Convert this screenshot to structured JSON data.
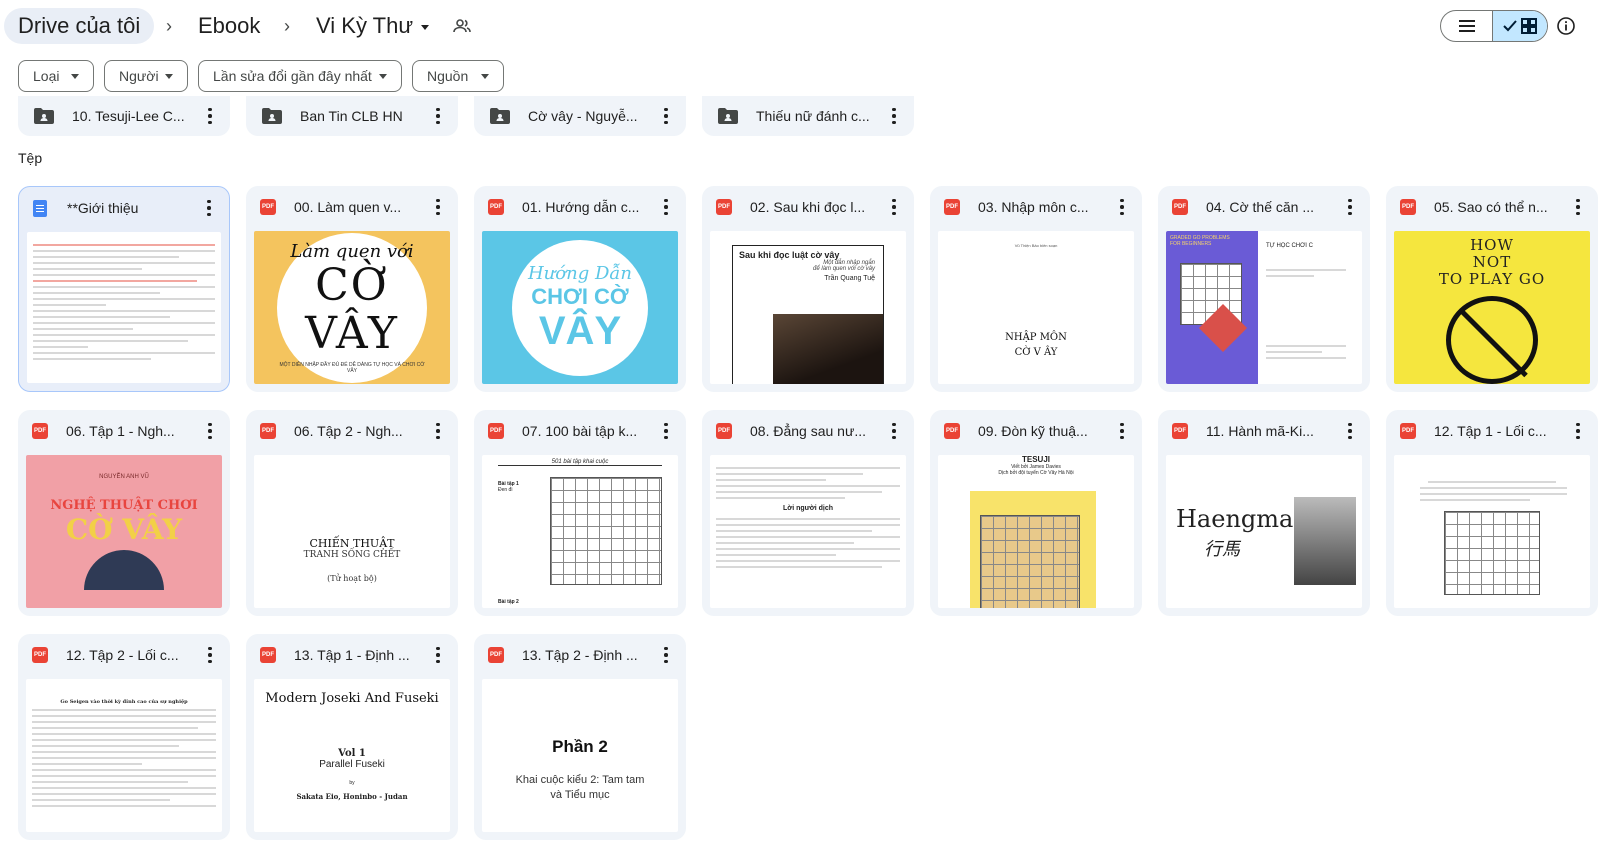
{
  "breadcrumb": {
    "root": "Drive của tôi",
    "level1": "Ebook",
    "current": "Vi Kỳ Thư"
  },
  "filters": [
    {
      "label": "Loại"
    },
    {
      "label": "Người"
    },
    {
      "label": "Lần sửa đổi gần đây nhất"
    },
    {
      "label": "Nguồn"
    }
  ],
  "folders": [
    {
      "name": "10. Tesuji-Lee C..."
    },
    {
      "name": "Ban Tin CLB HN"
    },
    {
      "name": "Cờ vây - Nguyễ..."
    },
    {
      "name": "Thiếu nữ đánh c..."
    }
  ],
  "files_section_label": "Tệp",
  "file_icon_label": "PDF",
  "files": [
    {
      "name": "**Giới thiệu",
      "type": "doc"
    },
    {
      "name": "00. Làm quen v...",
      "type": "pdf"
    },
    {
      "name": "01. Hướng dẫn c...",
      "type": "pdf"
    },
    {
      "name": "02. Sau khi đọc l...",
      "type": "pdf"
    },
    {
      "name": "03. Nhập môn c...",
      "type": "pdf"
    },
    {
      "name": "04. Cờ thế căn ...",
      "type": "pdf"
    },
    {
      "name": "05. Sao có thể n...",
      "type": "pdf"
    },
    {
      "name": "06. Tập 1 - Ngh...",
      "type": "pdf"
    },
    {
      "name": "06. Tập 2 - Ngh...",
      "type": "pdf"
    },
    {
      "name": "07. 100 bài tập k...",
      "type": "pdf"
    },
    {
      "name": "08. Đẳng sau nư...",
      "type": "pdf"
    },
    {
      "name": "09. Đòn kỹ thuậ...",
      "type": "pdf"
    },
    {
      "name": "11. Hành mã-Ki...",
      "type": "pdf"
    },
    {
      "name": "12. Tập 1 - Lối c...",
      "type": "pdf"
    },
    {
      "name": "12. Tập 2 - Lối c...",
      "type": "pdf"
    },
    {
      "name": "13. Tập 1 - Định ...",
      "type": "pdf"
    },
    {
      "name": "13. Tập 2 - Định ...",
      "type": "pdf"
    }
  ],
  "thumbs": {
    "t1": {
      "small": "Làm quen với",
      "big": "CỜ VÂY",
      "tiny": "MỘT DIỄN NHẬP ĐẦY ĐỦ ĐỂ DỄ DÀNG TỰ HỌC VÀ CHƠI CỜ VÂY"
    },
    "t2": {
      "l1": "Hướng Dẫn",
      "l2": "CHƠI CỜ",
      "l3": "VÂY"
    },
    "t3": {
      "title": "Sau khi đọc luật cờ vây",
      "sub1": "Một dẫn nhập ngắn",
      "sub2": "để làm quen với cờ vây",
      "author": "Trần Quang Tuệ"
    },
    "t4": {
      "top": "Vũ Thiện Bảo biên soạn",
      "title1": "NHẬP MÔN",
      "title2": "CỜ V ÂY"
    },
    "t5": {
      "left1": "GRADED GO PROBLEMS",
      "left2": "FOR BEGINNERS",
      "right": "TỰ HỌC CHƠI C"
    },
    "t6": {
      "l1": "HOW",
      "l2": "NOT",
      "l3": "TO PLAY GO"
    },
    "t7": {
      "author": "NGUYỄN ANH VŨ",
      "l1": "NGHỆ THUẬT CHƠI",
      "l2": "CỜ VÂY"
    },
    "t8": {
      "l1": "CHIẾN THUẬT",
      "l2": "TRANH SỐNG CHẾT",
      "l3": "(Tử hoạt bộ)"
    },
    "t9": {
      "header": "501 bài tập khai cuộc",
      "ex1": "Bài tập 1",
      "ex1b": "Đen đi",
      "ex2": "Bài tập 2"
    },
    "t10": {
      "heading": "Lời người dịch"
    },
    "t11": {
      "title": "TESUJI",
      "sub1": "Viết bởi James Davies",
      "sub2": "Dịch bởi đội tuyển Cờ Vây Hà Nội"
    },
    "t12": {
      "title": "Haengma",
      "kanji": "行馬"
    },
    "t14": {
      "head": "Go Seigen vào thời kỳ đỉnh cao của sự nghiệp"
    },
    "t15": {
      "title": "Modern Joseki And Fuseki",
      "vol": "Vol 1",
      "sub": "Parallel Fuseki",
      "by": "by",
      "authors": "Sakata Eio,  Honinbo - Judan"
    },
    "t16": {
      "title": "Phần 2",
      "sub1": "Khai cuộc kiểu 2: Tam tam",
      "sub2": "và Tiểu mục"
    }
  },
  "colors": {
    "accent_bg": "#c2e7ff",
    "card_bg": "#f0f4f9",
    "pdf_red": "#ea4335",
    "doc_blue": "#4285f4"
  }
}
